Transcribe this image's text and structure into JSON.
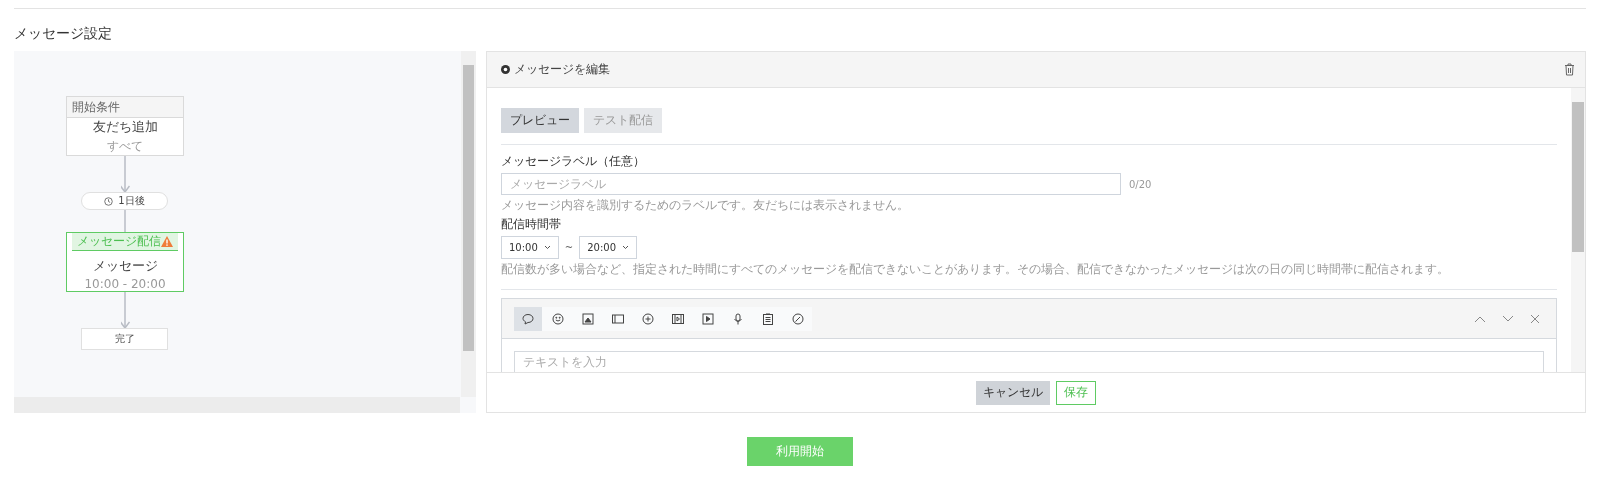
{
  "page_title": "メッセージ設定",
  "flow": {
    "nodes": [
      {
        "kind": "condition",
        "header": "開始条件",
        "title": "友だち追加",
        "subtitle": "すべて",
        "selected": false,
        "warning": false
      },
      {
        "kind": "delay",
        "label": "1日後"
      },
      {
        "kind": "message",
        "header": "メッセージ配信",
        "title": "メッセージ",
        "subtitle": "10:00 - 20:00",
        "selected": true,
        "warning": true
      },
      {
        "kind": "end",
        "label": "完了"
      }
    ]
  },
  "editor": {
    "header": "メッセージを編集",
    "tabs": [
      {
        "label": "プレビュー",
        "selected": true
      },
      {
        "label": "テスト配信",
        "selected": false
      }
    ],
    "label_field": {
      "label": "メッセージラベル（任意）",
      "placeholder": "メッセージラベル",
      "counter": "0/20",
      "hint": "メッセージ内容を識別するためのラベルです。友だちには表示されません。"
    },
    "schedule": {
      "label": "配信時間帯",
      "start": "10:00",
      "separator": "~",
      "end": "20:00",
      "hint": "配信数が多い場合など、指定された時間にすべてのメッセージを配信できないことがあります。その場合、配信できなかったメッセージは次の日の同じ時間帯に配信されます。"
    },
    "composer": {
      "tools": [
        {
          "kind": "text",
          "selected": true
        },
        {
          "kind": "sticker",
          "selected": false
        },
        {
          "kind": "image",
          "selected": false
        },
        {
          "kind": "card",
          "selected": false
        },
        {
          "kind": "bubble-plus",
          "selected": false
        },
        {
          "kind": "film",
          "selected": false
        },
        {
          "kind": "video",
          "selected": false
        },
        {
          "kind": "audio",
          "selected": false
        },
        {
          "kind": "clipboard",
          "selected": false
        },
        {
          "kind": "pencil",
          "selected": false
        }
      ],
      "placeholder": "テキストを入力"
    },
    "buttons": [
      {
        "label": "キャンセル",
        "kind": "secondary"
      },
      {
        "label": "保存",
        "kind": "outline"
      }
    ]
  },
  "submit": "利用開始"
}
